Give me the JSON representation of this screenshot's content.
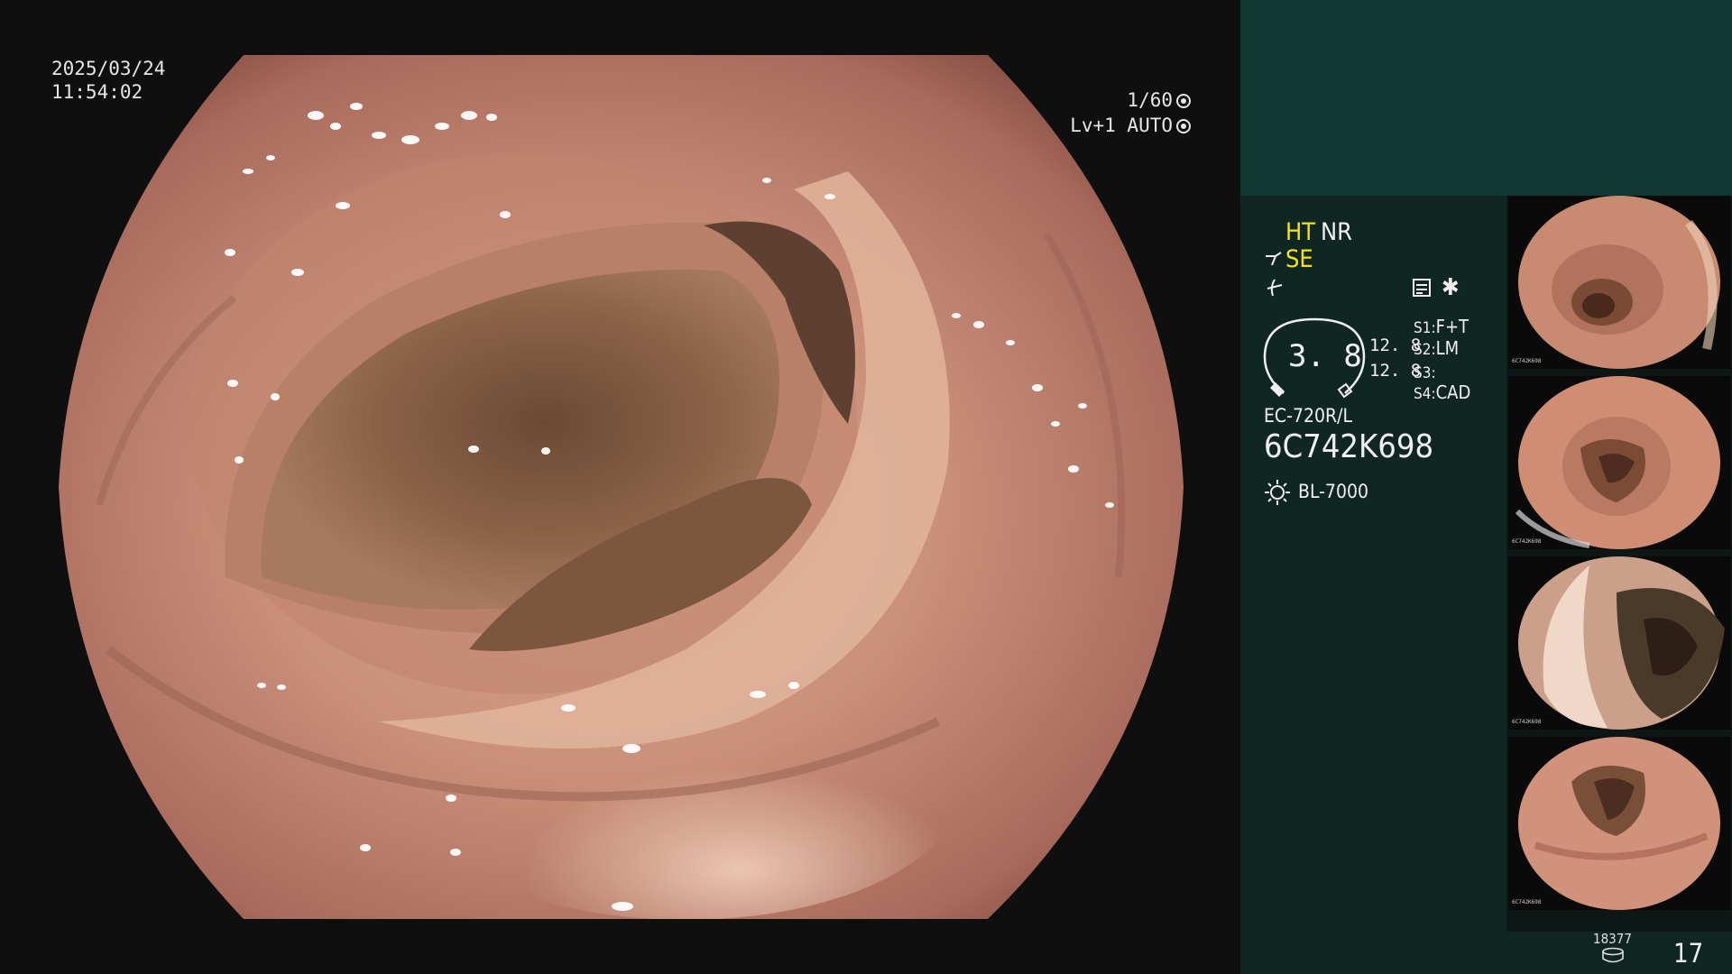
{
  "overlay": {
    "date": "2025/03/24",
    "time": "11:54:02",
    "shutter": "1/60",
    "level": "Lv+1",
    "exposure_mode": "AUTO"
  },
  "status": {
    "ht": "HT",
    "nr": "NR",
    "se": "SE",
    "zoom_value": "3. 8",
    "zoom_a": "12. 8",
    "zoom_b": "12. 8",
    "s1_label": "S1:",
    "s1_value": "F+T",
    "s2_label": "S2:",
    "s2_value": "LM",
    "s3_label": "S3:",
    "s3_value": "",
    "s4_label": "S4:",
    "s4_value": "CAD",
    "scope_model": "EC-720R/L",
    "scope_serial": "6C742K698",
    "light_source": "BL-7000"
  },
  "thumbnails": [
    {
      "serial": "6C742K698"
    },
    {
      "serial": "6C742K698"
    },
    {
      "serial": "6C742K698"
    },
    {
      "serial": "6C742K698"
    }
  ],
  "footer": {
    "storage_count": "18377",
    "image_count": "17"
  },
  "colors": {
    "yellow_accent": "#f5e11a",
    "panel_top": "#123834",
    "panel_info": "#102622"
  }
}
